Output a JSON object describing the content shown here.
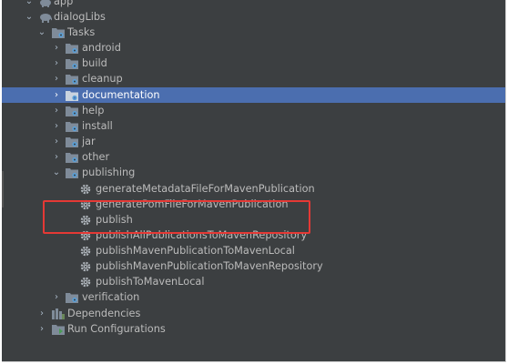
{
  "tree": {
    "app_label": "app",
    "module_label": "dialogLibs",
    "tasks_label": "Tasks",
    "task_groups": [
      "android",
      "build",
      "cleanup",
      "documentation",
      "help",
      "install",
      "jar",
      "other"
    ],
    "publishing_label": "publishing",
    "publishing_tasks": [
      "generateMetadataFileForMavenPublication",
      "generatePomFileForMavenPublication",
      "publish",
      "publishAllPublicationsToMavenRepository",
      "publishMavenPublicationToMavenLocal",
      "publishMavenPublicationToMavenRepository",
      "publishToMavenLocal"
    ],
    "verification_label": "verification",
    "dependencies_label": "Dependencies",
    "run_configurations_label": "Run Configurations",
    "selected_item": "documentation",
    "highlighted_tasks": [
      "generatePomFileForMavenPublication",
      "publish"
    ]
  },
  "colors": {
    "background": "#3c3f41",
    "selection": "#4b6eaf",
    "text": "#bbbbbb",
    "folder": "#7f8b99",
    "gear": "#aeb4ba",
    "highlight_border": "#e53935"
  },
  "icons": {
    "module": "elephant-icon",
    "folder": "folder-gear-icon",
    "task": "gear-icon",
    "dependencies": "dependencies-icon",
    "run_configurations": "run-configurations-icon"
  }
}
